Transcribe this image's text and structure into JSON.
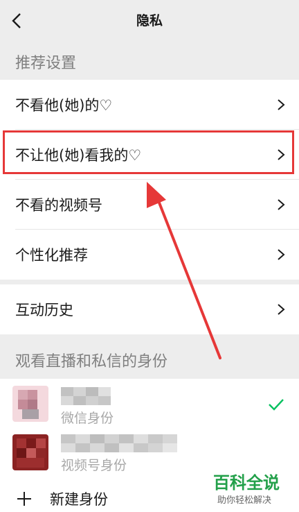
{
  "header": {
    "title": "隐私"
  },
  "recommend": {
    "section_title": "推荐设置",
    "items": [
      {
        "label": "不看他(她)的♡"
      },
      {
        "label": "不让他(她)看我的♡"
      },
      {
        "label": "不看的视频号"
      },
      {
        "label": "个性化推荐"
      }
    ]
  },
  "history": {
    "label": "互动历史"
  },
  "identity": {
    "section_title": "观看直播和私信的身份",
    "items": [
      {
        "subtitle": "微信身份",
        "selected": true
      },
      {
        "subtitle": "视频号身份",
        "selected": false
      }
    ],
    "add_label": "新建身份"
  },
  "watermark": {
    "title": "百科全说",
    "subtitle": "助你轻松解决"
  },
  "colors": {
    "accent_green": "#07c160",
    "highlight_red": "#e63838"
  },
  "icons": [
    "back-arrow-icon",
    "chevron-right-icon",
    "check-icon",
    "plus-icon"
  ]
}
